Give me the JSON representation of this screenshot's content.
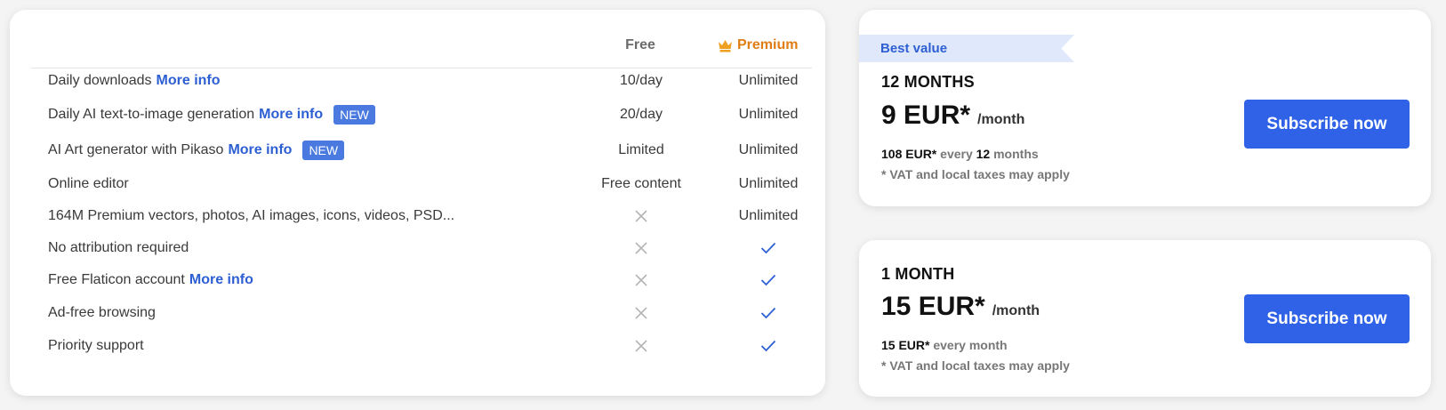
{
  "comparison": {
    "columns": {
      "free": "Free",
      "premium": "Premium"
    },
    "rows": [
      {
        "label": "Daily downloads",
        "more": "More info",
        "badge": "",
        "free": "10/day",
        "premium": "Unlimited"
      },
      {
        "label": "Daily AI text-to-image generation",
        "more": "More info",
        "badge": "NEW",
        "free": "20/day",
        "premium": "Unlimited"
      },
      {
        "label": "AI Art generator with Pikaso",
        "more": "More info",
        "badge": "NEW",
        "free": "Limited",
        "premium": "Unlimited"
      },
      {
        "label": "Online editor",
        "more": "",
        "badge": "",
        "free": "Free content",
        "premium": "Unlimited"
      },
      {
        "label": "164M Premium vectors, photos, AI images, icons, videos, PSD...",
        "more": "",
        "badge": "",
        "free": "",
        "premium": "Unlimited"
      },
      {
        "label": "No attribution required",
        "more": "",
        "badge": "",
        "free": "",
        "premium": ""
      },
      {
        "label": "Free Flaticon account",
        "more": "More info",
        "badge": "",
        "free": "",
        "premium": ""
      },
      {
        "label": "Ad-free browsing",
        "more": "",
        "badge": "",
        "free": "",
        "premium": ""
      },
      {
        "label": "Priority support",
        "more": "",
        "badge": "",
        "free": "",
        "premium": ""
      }
    ],
    "icons": [
      "crown-icon",
      "cross-icon",
      "check-icon"
    ]
  },
  "plans": [
    {
      "ribbon": "Best value",
      "period": "12 MONTHS",
      "price": "9 EUR*",
      "unit": "/month",
      "total": "108 EUR*",
      "every": "every",
      "count": "12",
      "count_unit": "months",
      "vat": "* VAT and local taxes may apply",
      "button": "Subscribe now"
    },
    {
      "ribbon": "",
      "period": "1 MONTH",
      "price": "15 EUR*",
      "unit": "/month",
      "total": "15 EUR*",
      "every": "every month",
      "vat": "* VAT and local taxes may apply",
      "button": "Subscribe now"
    }
  ],
  "colors": {
    "accent": "#2f62e6",
    "link": "#2d5fd3",
    "premium": "#e07d14",
    "badge": "#4a79e0",
    "ribbon_bg": "#e0e9fb"
  }
}
